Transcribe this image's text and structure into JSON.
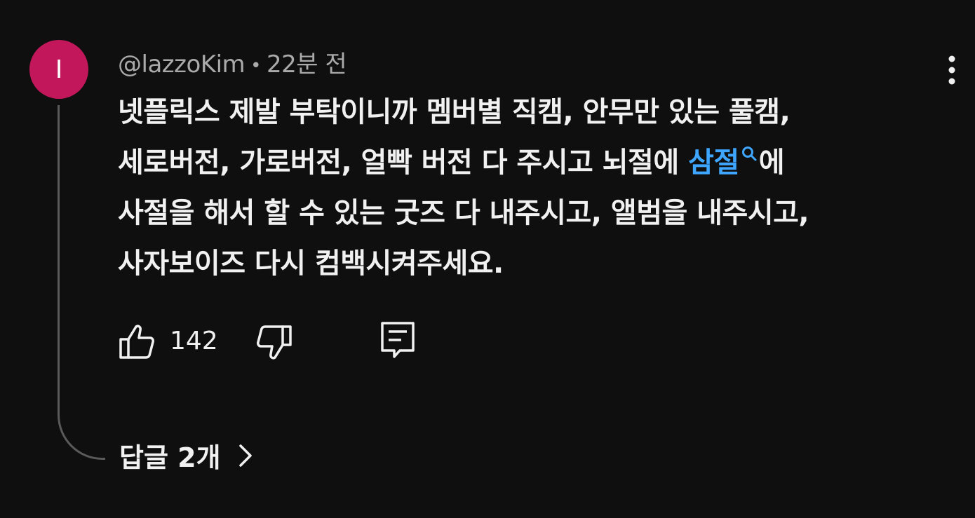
{
  "comment": {
    "avatar_initial": "I",
    "avatar_color": "#c2185b",
    "author": "@lazzoKim",
    "separator": "•",
    "time": "22분 전",
    "lines": [
      "넷플릭스 제발 부탁이니까 멤버별 직캠, 안무만 있는 풀캠,",
      "세로버전, 가로버전, 얼빡 버전 다 주시고 뇌절에 "
    ],
    "link_text": "삼절",
    "link_color": "#3ea6ff",
    "line2_suffix": "에",
    "lines_after": [
      "사절을 해서 할 수 있는 굿즈 다 내주시고, 앨범을 내주시고,",
      "사자보이즈 다시 컴백시켜주세요."
    ],
    "like_count": "142",
    "replies_label": "답글 2개"
  },
  "icons": {
    "more": "more-vert-icon",
    "like": "thumb-up-icon",
    "dislike": "thumb-down-icon",
    "reply": "reply-comment-icon",
    "link_search": "search-icon",
    "replies_chevron": "chevron-right-icon"
  }
}
